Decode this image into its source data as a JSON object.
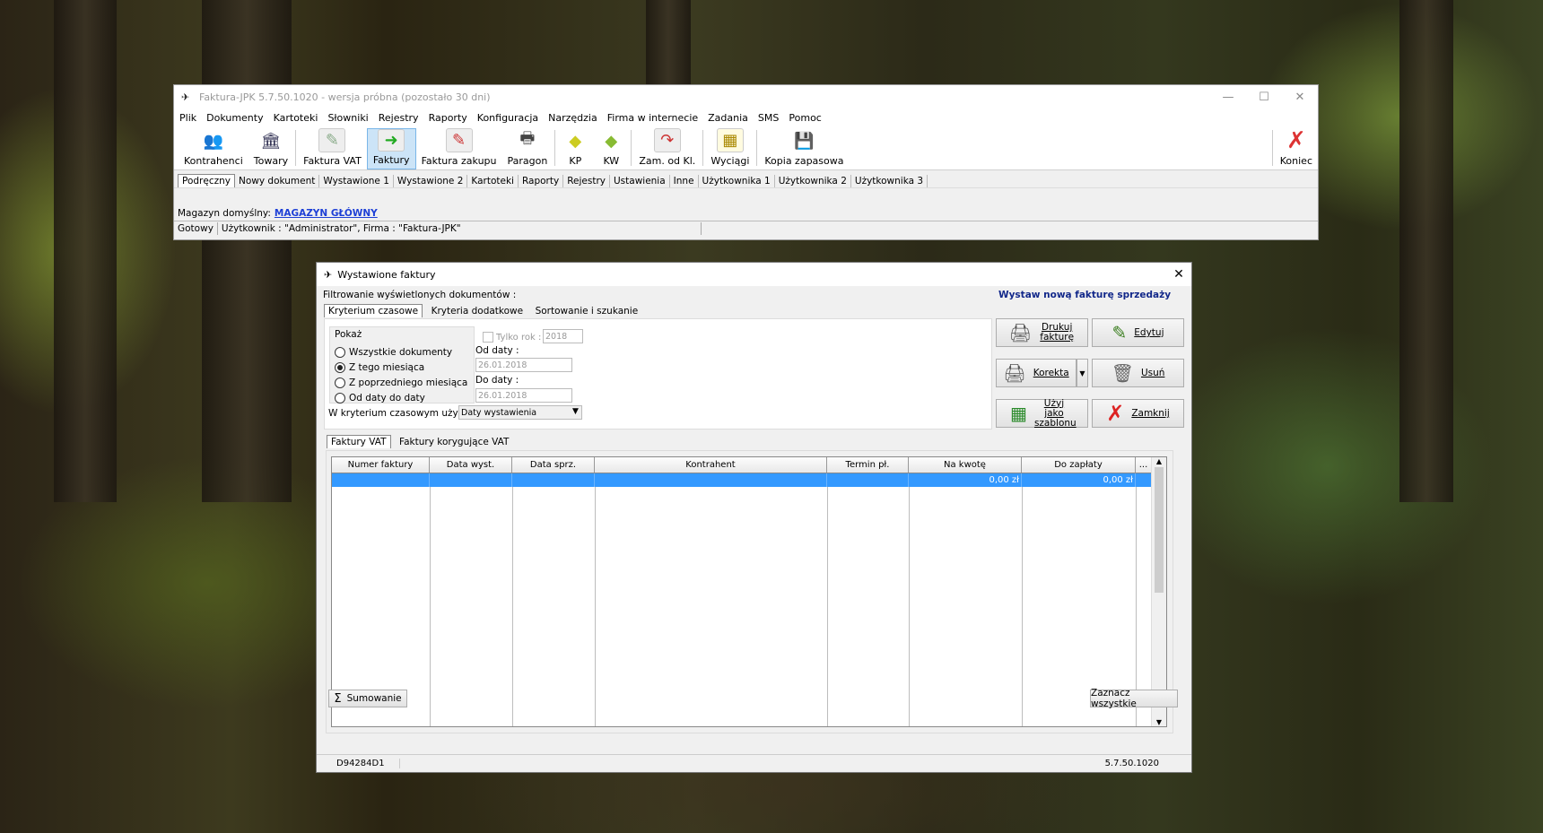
{
  "main_window": {
    "title": "Faktura-JPK 5.7.50.1020 - wersja próbna (pozostało 30 dni)",
    "menu": [
      "Plik",
      "Dokumenty",
      "Kartoteki",
      "Słowniki",
      "Rejestry",
      "Raporty",
      "Konfiguracja",
      "Narzędzia",
      "Firma w internecie",
      "Zadania",
      "SMS",
      "Pomoc"
    ],
    "toolbar": {
      "kontrahenci": "Kontrahenci",
      "towary": "Towary",
      "faktura_vat": "Faktura VAT",
      "faktury": "Faktury",
      "faktura_zakupu": "Faktura zakupu",
      "paragon": "Paragon",
      "kp": "KP",
      "kw": "KW",
      "zam": "Zam. od Kl.",
      "wyciagi": "Wyciągi",
      "kopia": "Kopia zapasowa",
      "koniec": "Koniec"
    },
    "tabs": [
      "Podręczny",
      "Nowy dokument",
      "Wystawione 1",
      "Wystawione 2",
      "Kartoteki",
      "Raporty",
      "Rejestry",
      "Ustawienia",
      "Inne",
      "Użytkownika 1",
      "Użytkownika 2",
      "Użytkownika 3"
    ],
    "magazyn_label": "Magazyn domyślny:",
    "magazyn_value": "MAGAZYN GŁÓWNY",
    "status_ready": "Gotowy",
    "status_user": "Użytkownik : \"Administrator\", Firma : \"Faktura-JPK\""
  },
  "dialog": {
    "title": "Wystawione faktury",
    "filter_label": "Filtrowanie wyświetlonych dokumentów :",
    "new_invoice_link": "Wystaw nową fakturę sprzedaży",
    "filter_tabs": [
      "Kryterium czasowe",
      "Kryteria dodatkowe",
      "Sortowanie i szukanie"
    ],
    "pokaz_label": "Pokaż",
    "radios": [
      "Wszystkie dokumenty",
      "Z tego miesiąca",
      "Z poprzedniego miesiąca",
      "Od daty do daty"
    ],
    "selected_radio": 1,
    "tylko_rok_label": "Tylko rok :",
    "tylko_rok_value": "2018",
    "od_daty_label": "Od daty :",
    "od_daty_value": "26.01.2018",
    "do_daty_label": "Do daty :",
    "do_daty_value": "26.01.2018",
    "criterion_label": "W kryterium czasowym używaj:",
    "criterion_value": "Daty wystawienia",
    "buttons": {
      "drukuj": "Drukuj fakturę",
      "edytuj": "Edytuj",
      "korekta": "Korekta",
      "usun": "Usuń",
      "szablon": "Użyj jako szablonu",
      "zamknij": "Zamknij"
    },
    "list_tabs": [
      "Faktury VAT",
      "Faktury korygujące VAT"
    ],
    "columns": [
      "Numer faktury",
      "Data wyst.",
      "Data sprz.",
      "Kontrahent",
      "Termin pł.",
      "Na kwotę",
      "Do zapłaty",
      "..."
    ],
    "row": {
      "na_kwote": "0,00 zł",
      "do_zaplaty": "0,00 zł"
    },
    "sumowanie": "Sumowanie",
    "zaznacz": "Zaznacz wszystkie",
    "status_left": "D94284D1",
    "status_right": "5.7.50.1020"
  }
}
